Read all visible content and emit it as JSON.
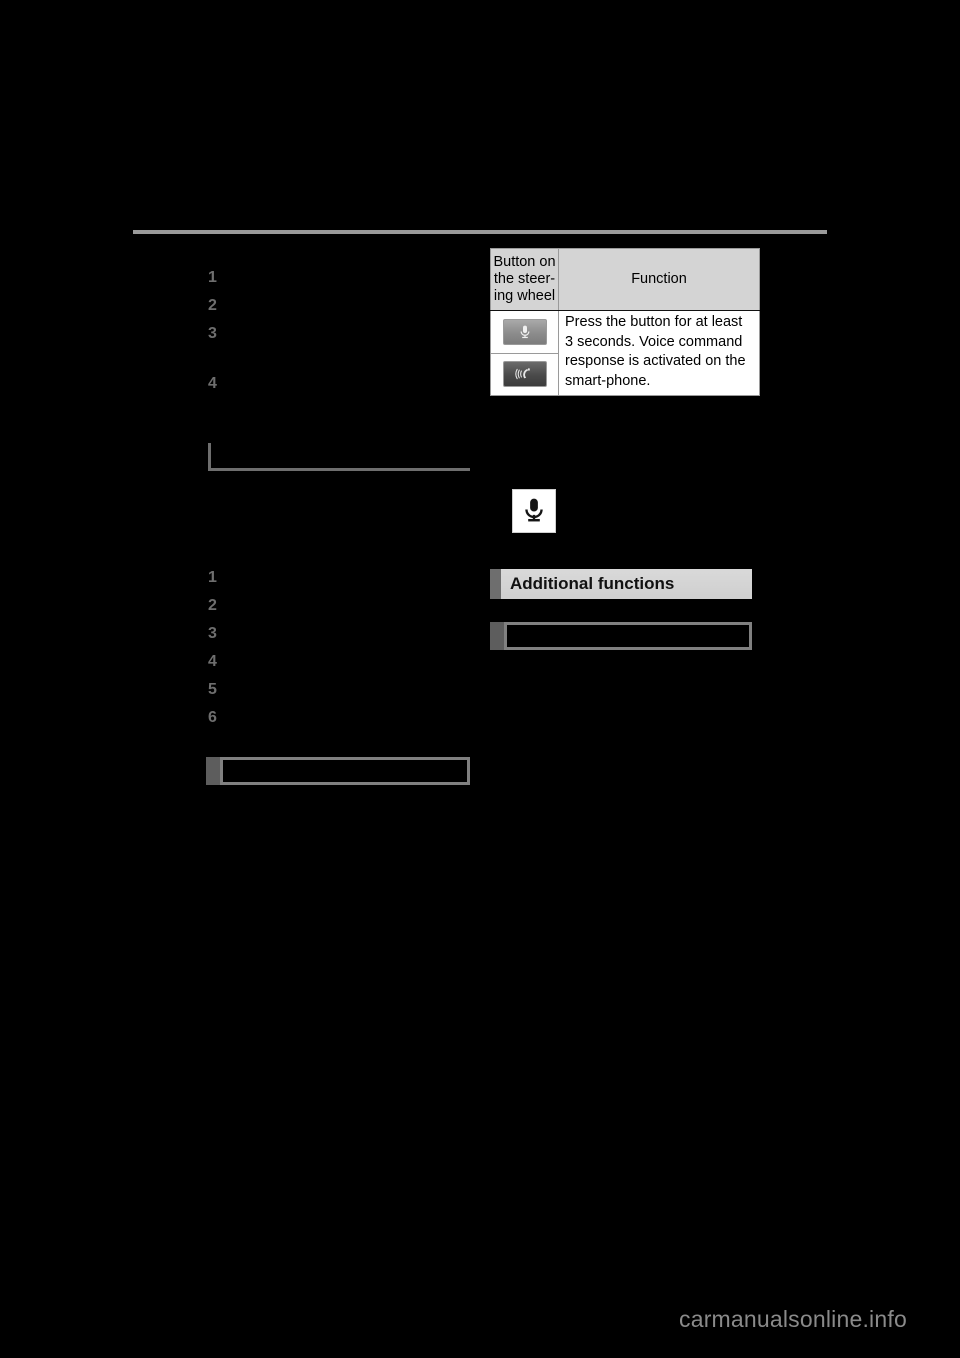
{
  "page": {
    "background_color": "#000000",
    "rule_color": "#9a9a9a",
    "accent_gray": "#6e6e6e"
  },
  "left_column": {
    "list_one": {
      "numbers": [
        "1",
        "2",
        "3",
        "4"
      ],
      "items": [
        "",
        "",
        "",
        ""
      ]
    },
    "list_two": {
      "numbers": [
        "1",
        "2",
        "3",
        "4",
        "5",
        "6"
      ],
      "items": [
        "",
        "",
        "",
        "",
        "",
        ""
      ]
    },
    "note_box": {
      "text": ""
    }
  },
  "right_column": {
    "table": {
      "headers": [
        "Button on the steer- ing wheel",
        "Function"
      ],
      "header_button_label": "Button on the steering wheel",
      "header_function_label": "Function",
      "rows": [
        {
          "icon": "microphone-button-icon",
          "function": "Press the button for at least 3 seconds. Voice command response is activated on the smart-phone."
        },
        {
          "icon": "talk-button-icon",
          "function": ""
        }
      ]
    },
    "standalone_icon": "microphone-icon",
    "section_heading": "Additional functions",
    "note_box": {
      "text": ""
    }
  },
  "footer": {
    "watermark": "carmanualsonline.info"
  }
}
